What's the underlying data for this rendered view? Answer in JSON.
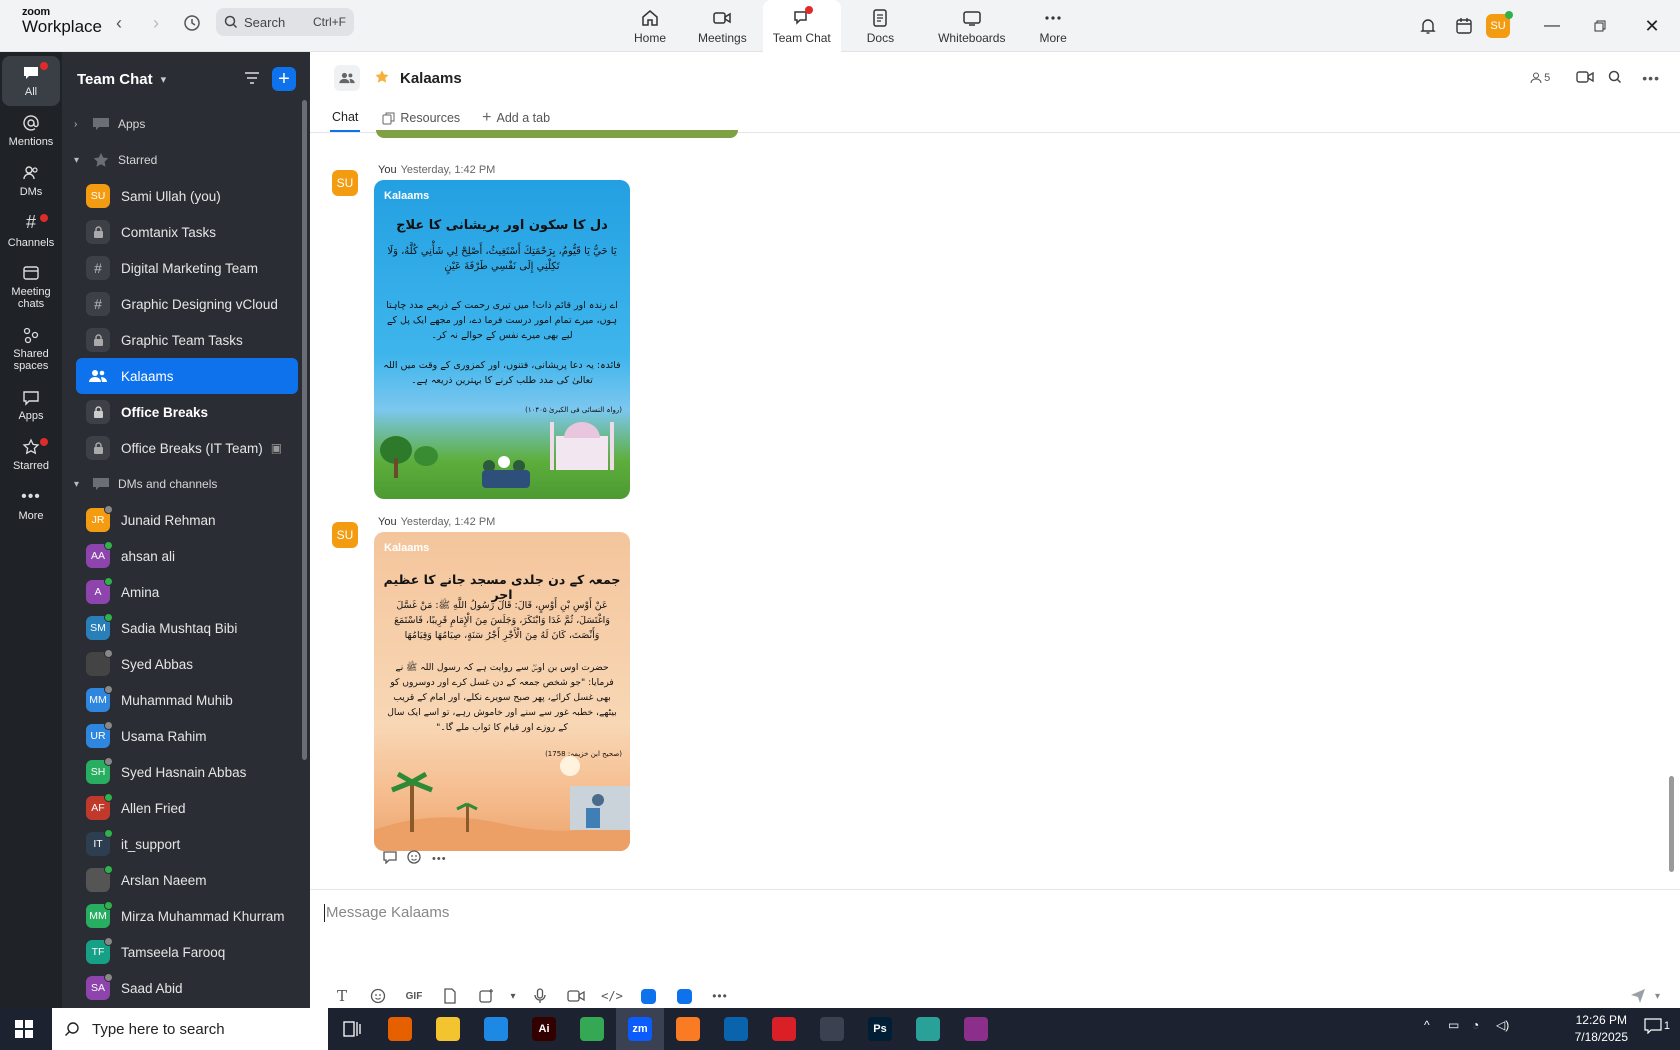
{
  "app": {
    "logo_top": "zoom",
    "logo_bottom": "Workplace"
  },
  "search": {
    "placeholder": "Search",
    "shortcut": "Ctrl+F"
  },
  "topnav": [
    {
      "label": "Home",
      "icon": "home-icon"
    },
    {
      "label": "Meetings",
      "icon": "video-camera-icon"
    },
    {
      "label": "Team Chat",
      "icon": "chat-icon",
      "active": true
    },
    {
      "label": "Docs",
      "icon": "document-icon"
    },
    {
      "label": "Whiteboards",
      "icon": "whiteboard-icon"
    },
    {
      "label": "More",
      "icon": "more-dots-icon"
    }
  ],
  "user_avatar": "SU",
  "rail": [
    {
      "label": "All",
      "active": true
    },
    {
      "label": "Mentions"
    },
    {
      "label": "DMs"
    },
    {
      "label": "Channels"
    },
    {
      "label": "Meeting chats"
    },
    {
      "label": "Shared spaces"
    },
    {
      "label": "Apps"
    },
    {
      "label": "Starred"
    },
    {
      "label": "More"
    }
  ],
  "sidebar": {
    "title": "Team Chat",
    "apps_label": "Apps",
    "starred_label": "Starred",
    "starred": [
      {
        "label": "Sami Ullah (you)",
        "kind": "avatar",
        "initials": "SU",
        "color": "#f39c12"
      },
      {
        "label": "Comtanix Tasks",
        "kind": "lock"
      },
      {
        "label": "Digital Marketing Team",
        "kind": "hash"
      },
      {
        "label": "Graphic Designing vCloud",
        "kind": "hash"
      },
      {
        "label": "Graphic Team Tasks",
        "kind": "lock"
      },
      {
        "label": "Kalaams",
        "kind": "group",
        "active": true
      },
      {
        "label": "Office Breaks",
        "kind": "lock",
        "bold": true
      },
      {
        "label": "Office Breaks (IT Team)",
        "kind": "lock"
      }
    ],
    "dms_label": "DMs and channels",
    "dms": [
      {
        "label": "Junaid Rehman",
        "initials": "JR",
        "color": "#f39c12",
        "presence": "grey"
      },
      {
        "label": "ahsan ali",
        "initials": "AA",
        "color": "#8e44ad",
        "presence": "green"
      },
      {
        "label": "Amina",
        "initials": "A",
        "color": "#8e44ad",
        "presence": "green"
      },
      {
        "label": "Sadia Mushtaq Bibi",
        "initials": "SM",
        "color": "#2980b9",
        "presence": "green"
      },
      {
        "label": "Syed Abbas",
        "initials": "",
        "color": "#444",
        "presence": "grey"
      },
      {
        "label": "Muhammad Muhib",
        "initials": "MM",
        "color": "#2e86de",
        "presence": "grey"
      },
      {
        "label": "Usama Rahim",
        "initials": "UR",
        "color": "#2e86de",
        "presence": "grey"
      },
      {
        "label": "Syed Hasnain Abbas",
        "initials": "SH",
        "color": "#27ae60",
        "presence": "grey"
      },
      {
        "label": "Allen Fried",
        "initials": "AF",
        "color": "#c0392b",
        "presence": "green"
      },
      {
        "label": "it_support",
        "initials": "IT",
        "color": "#2c3e50",
        "presence": "green"
      },
      {
        "label": "Arslan Naeem",
        "initials": "",
        "color": "#555",
        "presence": "green"
      },
      {
        "label": "Mirza Muhammad Khurram",
        "initials": "MM",
        "color": "#27ae60",
        "presence": "green"
      },
      {
        "label": "Tamseela Farooq",
        "initials": "TF",
        "color": "#16a085",
        "presence": "grey"
      },
      {
        "label": "Saad Abid",
        "initials": "SA",
        "color": "#8e44ad",
        "presence": "grey"
      }
    ]
  },
  "channel": {
    "title": "Kalaams",
    "member_count": "5",
    "tabs": [
      "Chat",
      "Resources",
      "Add a tab"
    ]
  },
  "messages": [
    {
      "avatar": "SU",
      "sender": "You",
      "time": "Yesterday, 1:42 PM",
      "brand": "Kalaams",
      "heading": "دل کا سکون اور پریشانی کا علاج",
      "arabic": "يَا حَيُّ يَا قَيُّومُ، بِرَحْمَتِكَ أَسْتَغِيثُ، أَصْلِحْ لِي شَأْنِي كُلَّهُ، وَلَا تَكِلْنِي إِلَى نَفْسِي طَرْفَةَ عَيْنٍ",
      "translation": "اے زندہ اور قائم ذات! میں تیری رحمت کے ذریعے مدد چاہتا ہوں، میرے تمام امور درست فرما دے، اور مجھے ایک پل کے لیے بھی میرے نفس کے حوالے نہ کر۔",
      "benefit": "فائدہ: یہ دعا پریشانی، فتنوں، اور کمزوری کے وقت میں اللہ تعالیٰ کی مدد طلب کرنے کا بہترین ذریعہ ہے۔",
      "reference": "(رواہ النسائی فی الکبریٰ ۱۰۴۰۵)",
      "bg": "#2aa5e0"
    },
    {
      "avatar": "SU",
      "sender": "You",
      "time": "Yesterday, 1:42 PM",
      "brand": "Kalaams",
      "heading": "جمعہ کے دن جلدی مسجد جانے کا عظیم اجر",
      "arabic": "عَنْ أَوْسِ بْنِ أَوْسٍ، قَالَ: قَالَ رَسُولُ اللَّهِ ﷺ: مَنْ غَسَّلَ وَاغْتَسَلَ، ثُمَّ غَدَا وَابْتَكَرَ، وَجَلَسَ مِنَ الْإِمَامِ قَرِيبًا، فَاسْتَمَعَ وَأَنْصَتَ، كَانَ لَهُ مِنَ الْأَجْرِ أَجْرُ سَنَةٍ، صِيَامُهَا وَقِيَامُهَا",
      "translation": "حضرت اوس بن اوسؓ سے روایت ہے کہ رسول اللہ ﷺ نے فرمایا: \"جو شخص جمعہ کے دن غسل کرے اور دوسروں کو بھی غسل کرائے، پھر صبح سویرے نکلے، اور امام کے قریب بیٹھے، خطبہ غور سے سنے اور خاموش رہے، تو اسے ایک سال کے روزے اور قیام کا ثواب ملے گا۔\"",
      "reference": "(صحیح ابن خزیمہ: 1758)",
      "bg": "#f6c9a0"
    }
  ],
  "composer": {
    "placeholder": "Message Kalaams",
    "gif": "GIF"
  },
  "taskbar": {
    "search_placeholder": "Type here to search",
    "time": "12:26 PM",
    "date": "7/18/2025",
    "notif_count": "1",
    "apps": [
      {
        "name": "firefox-icon",
        "label": "",
        "color": "#e66000"
      },
      {
        "name": "file-explorer-icon",
        "label": "",
        "color": "#f4c430"
      },
      {
        "name": "vscode-icon",
        "label": "",
        "color": "#1e88e5"
      },
      {
        "name": "illustrator-icon",
        "label": "Ai",
        "color": "#330000"
      },
      {
        "name": "chrome-icon",
        "label": "",
        "color": "#34a853"
      },
      {
        "name": "zoom-icon",
        "label": "zm",
        "color": "#0b5cff"
      },
      {
        "name": "xampp-icon",
        "label": "",
        "color": "#fb7a24"
      },
      {
        "name": "outlook-icon",
        "label": "",
        "color": "#0a64ad"
      },
      {
        "name": "creative-cloud-icon",
        "label": "",
        "color": "#da1f26"
      },
      {
        "name": "pen-tool-icon",
        "label": "",
        "color": "#3a4150"
      },
      {
        "name": "photoshop-icon",
        "label": "Ps",
        "color": "#001e36"
      },
      {
        "name": "app-diamond-icon",
        "label": "",
        "color": "#2aa198"
      },
      {
        "name": "winrar-icon",
        "label": "",
        "color": "#8b2f8b"
      }
    ]
  }
}
